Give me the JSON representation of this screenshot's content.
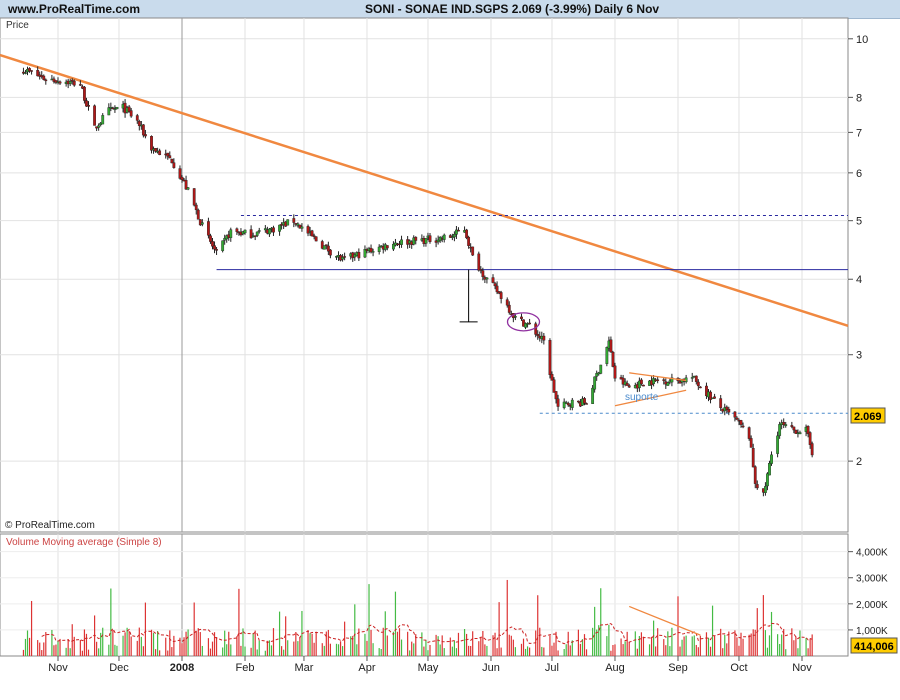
{
  "header": {
    "site": "www.ProRealTime.com",
    "title": "SONI - SONAE IND.SGPS   2.069 (-3.99%)   Daily  6 Nov"
  },
  "price_panel": {
    "label": "Price",
    "copyright": "© ProRealTime.com",
    "last_price": "2.069",
    "support_label": "suporte"
  },
  "volume_panel": {
    "label": "Volume Moving average (Simple 8)",
    "last_volume": "414,006"
  },
  "colors": {
    "header_bg": "#c9dbec",
    "up_candle": "#33aa33",
    "down_candle": "#b01818",
    "trendline": "#f08840",
    "support_line": "#2a2aa0",
    "resistance_dashed": "#2a2aa0",
    "support_dashed": "#4a8acc",
    "volume_up": "#44bb44",
    "volume_down": "#dd3333",
    "volume_ma": "#cc2222",
    "ellipse": "#9030a0",
    "price_badge": "#ffcc00"
  },
  "chart_data": [
    {
      "type": "candlestick",
      "y_scale": "log",
      "ylim": [
        1.55,
        10.5
      ],
      "y_ticks": [
        "2",
        "3",
        "4",
        "5",
        "6",
        "7",
        "8",
        "10"
      ],
      "y_tick_values": [
        2,
        3,
        4,
        5,
        6,
        7,
        8,
        10
      ],
      "x_ticks": [
        "Nov",
        "Dec",
        "2008",
        "Feb",
        "Mar",
        "Apr",
        "May",
        "Jun",
        "Jul",
        "Aug",
        "Sep",
        "Oct",
        "Nov"
      ],
      "close_path": [
        [
          "2007-10-15",
          8.9
        ],
        [
          "2007-10-25",
          8.6
        ],
        [
          "2007-11-05",
          8.5
        ],
        [
          "2007-11-12",
          8.4
        ],
        [
          "2007-11-19",
          7.1
        ],
        [
          "2007-11-26",
          7.6
        ],
        [
          "2007-12-03",
          7.7
        ],
        [
          "2007-12-10",
          7.3
        ],
        [
          "2007-12-17",
          6.6
        ],
        [
          "2007-12-27",
          6.3
        ],
        [
          "2008-01-04",
          5.6
        ],
        [
          "2008-01-11",
          4.9
        ],
        [
          "2008-01-18",
          4.4
        ],
        [
          "2008-01-25",
          4.8
        ],
        [
          "2008-02-04",
          4.75
        ],
        [
          "2008-02-15",
          4.85
        ],
        [
          "2008-02-25",
          5.0
        ],
        [
          "2008-03-05",
          4.7
        ],
        [
          "2008-03-12",
          4.5
        ],
        [
          "2008-03-20",
          4.3
        ],
        [
          "2008-04-01",
          4.45
        ],
        [
          "2008-04-15",
          4.6
        ],
        [
          "2008-05-01",
          4.65
        ],
        [
          "2008-05-12",
          4.7
        ],
        [
          "2008-05-19",
          4.85
        ],
        [
          "2008-05-23",
          4.35
        ],
        [
          "2008-05-30",
          4.0
        ],
        [
          "2008-06-06",
          3.75
        ],
        [
          "2008-06-13",
          3.45
        ],
        [
          "2008-06-20",
          3.35
        ],
        [
          "2008-06-27",
          3.15
        ],
        [
          "2008-07-01",
          2.7
        ],
        [
          "2008-07-04",
          2.45
        ],
        [
          "2008-07-10",
          2.5
        ],
        [
          "2008-07-18",
          2.5
        ],
        [
          "2008-07-25",
          2.9
        ],
        [
          "2008-07-29",
          3.15
        ],
        [
          "2008-08-01",
          2.75
        ],
        [
          "2008-08-08",
          2.65
        ],
        [
          "2008-08-15",
          2.7
        ],
        [
          "2008-08-22",
          2.72
        ],
        [
          "2008-09-01",
          2.72
        ],
        [
          "2008-09-08",
          2.75
        ],
        [
          "2008-09-15",
          2.6
        ],
        [
          "2008-09-22",
          2.45
        ],
        [
          "2008-09-29",
          2.35
        ],
        [
          "2008-10-06",
          2.2
        ],
        [
          "2008-10-09",
          1.85
        ],
        [
          "2008-10-13",
          1.75
        ],
        [
          "2008-10-17",
          2.05
        ],
        [
          "2008-10-21",
          2.3
        ],
        [
          "2008-10-27",
          2.25
        ],
        [
          "2008-11-03",
          2.25
        ],
        [
          "2008-11-06",
          2.069
        ]
      ],
      "annotations": {
        "trendline": [
          [
            "2007-10-15",
            9.4
          ],
          [
            "2008-11-12",
            3.35
          ]
        ],
        "resistance_dashed": 5.1,
        "support_line": 4.15,
        "support_dashed": 2.4,
        "support_dashed_label": "suporte",
        "triangle_upper": [
          [
            "2008-08-08",
            2.8
          ],
          [
            "2008-09-05",
            2.72
          ]
        ],
        "triangle_lower": [
          [
            "2008-08-01",
            2.47
          ],
          [
            "2008-09-05",
            2.62
          ]
        ],
        "measure_marker": {
          "date": "2008-05-21",
          "from": 4.15,
          "to": 3.4
        },
        "ellipse": {
          "date": "2008-06-17",
          "price": 3.4
        }
      }
    },
    {
      "type": "bar",
      "title": "Volume Moving average (Simple 8)",
      "ylim": [
        0,
        4600000
      ],
      "y_ticks": [
        "1,000K",
        "2,000K",
        "3,000K",
        "4,000K"
      ],
      "y_tick_values": [
        1000000,
        2000000,
        3000000,
        4000000
      ],
      "last_value": 414006,
      "annotation_line": [
        [
          "2008-08-08",
          1900000
        ],
        [
          "2008-09-12",
          800000
        ]
      ]
    }
  ]
}
